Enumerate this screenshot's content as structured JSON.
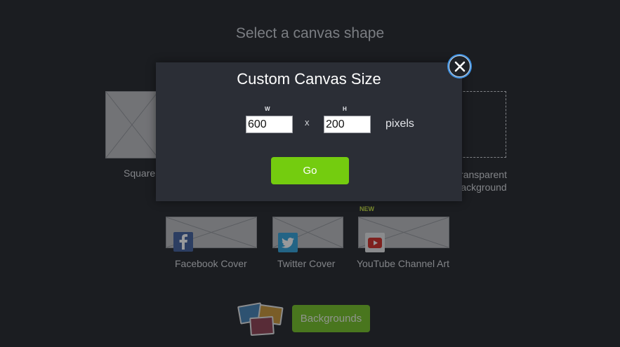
{
  "page": {
    "title": "Select a canvas shape"
  },
  "shapes": {
    "square_label": "Square",
    "transparent_label_line1": "Transparent",
    "transparent_label_line2": "Background",
    "facebook_label": "Facebook Cover",
    "twitter_label": "Twitter Cover",
    "youtube_label": "YouTube Channel Art",
    "new_badge": "NEW",
    "icons": {
      "facebook": "facebook-icon",
      "twitter": "twitter-icon",
      "youtube": "youtube-icon"
    }
  },
  "backgrounds": {
    "button_label": "Backgrounds",
    "icon": "photo-stack-icon"
  },
  "modal": {
    "title": "Custom Canvas Size",
    "width_label": "W",
    "height_label": "H",
    "width_value": "600",
    "height_value": "200",
    "separator": "x",
    "unit_label": "pixels",
    "go_label": "Go",
    "close_icon": "close-icon"
  },
  "colors": {
    "background": "#1b1d21",
    "modal": "#2b2e36",
    "accent_green": "#74cc0f",
    "close_ring": "#3e8fde",
    "new_badge": "#c6e23a"
  }
}
